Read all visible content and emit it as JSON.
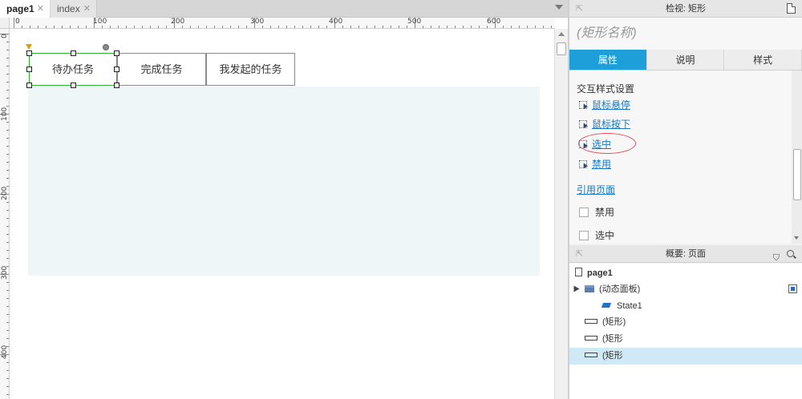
{
  "tabs": [
    {
      "label": "page1",
      "active": true
    },
    {
      "label": "index",
      "active": false
    }
  ],
  "ruler": {
    "h_labels": [
      "0",
      "100",
      "200",
      "300",
      "400",
      "500",
      "600"
    ],
    "v_labels": [
      "0",
      "100",
      "200",
      "300",
      "400"
    ]
  },
  "canvas": {
    "rects": [
      "待办任务",
      "完成任务",
      "我发起的任务"
    ]
  },
  "inspector": {
    "header": "检视: 矩形",
    "shape_name_placeholder": "(矩形名称)",
    "tabs": [
      "属性",
      "说明",
      "样式"
    ],
    "section_title": "交互样式设置",
    "interaction_links": [
      "鼠标悬停",
      "鼠标按下",
      "选中",
      "禁用"
    ],
    "ref_page": "引用页面",
    "checkboxes": [
      "禁用",
      "选中"
    ],
    "accent_color": "#1f9fd9"
  },
  "outline": {
    "header": "概要: 页面",
    "page": "page1",
    "items": [
      "(动态面板)",
      "State1",
      "(矩形)",
      "(矩形",
      "(矩形"
    ]
  }
}
